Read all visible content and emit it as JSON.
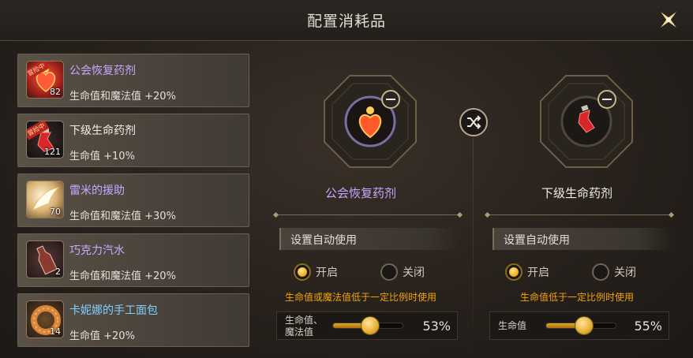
{
  "window": {
    "title": "配置消耗品"
  },
  "items": [
    {
      "name": "公会恢复药剂",
      "name_color": "#c6a8ff",
      "desc": "生命值和魔法值 +20%",
      "count": "82",
      "tag": "冒险中",
      "icon": "heart-potion-icon"
    },
    {
      "name": "下级生命药剂",
      "name_color": "#f2eee6",
      "desc": "生命值 +10%",
      "count": "121",
      "tag": "冒险中",
      "icon": "red-potion-icon"
    },
    {
      "name": "雷米的援助",
      "name_color": "#c6a8ff",
      "desc": "生命值和魔法值 +30%",
      "count": "70",
      "tag": "",
      "icon": "wing-icon"
    },
    {
      "name": "巧克力汽水",
      "name_color": "#c6a8ff",
      "desc": "生命值和魔法值 +20%",
      "count": "2",
      "tag": "",
      "icon": "soda-bottle-icon"
    },
    {
      "name": "卡妮娜的手工面包",
      "name_color": "#7fd0ff",
      "desc": "生命值 +20%",
      "count": "14",
      "tag": "",
      "icon": "bread-icon"
    }
  ],
  "slots": [
    {
      "label": "公会恢复药剂",
      "label_color": "#c6a8ff",
      "icon": "heart-potion-icon",
      "auto_use_label": "设置自动使用",
      "on_label": "开启",
      "off_label": "关闭",
      "enabled": true,
      "hint": "生命值或魔法值低于一定比例时使用",
      "slider_label_1": "生命值、",
      "slider_label_2": "魔法值",
      "percent": 53,
      "percent_text": "53%"
    },
    {
      "label": "下级生命药剂",
      "label_color": "#f2eee6",
      "icon": "red-potion-icon",
      "auto_use_label": "设置自动使用",
      "on_label": "开启",
      "off_label": "关闭",
      "enabled": true,
      "hint": "生命值低于一定比例时使用",
      "slider_label_1": "生命值",
      "slider_label_2": "",
      "percent": 55,
      "percent_text": "55%"
    }
  ],
  "colors": {
    "accent_gold": "#f3b21c",
    "hint_orange": "#f0a30a",
    "rare_purple": "#c6a8ff",
    "uncommon_blue": "#7fd0ff"
  }
}
